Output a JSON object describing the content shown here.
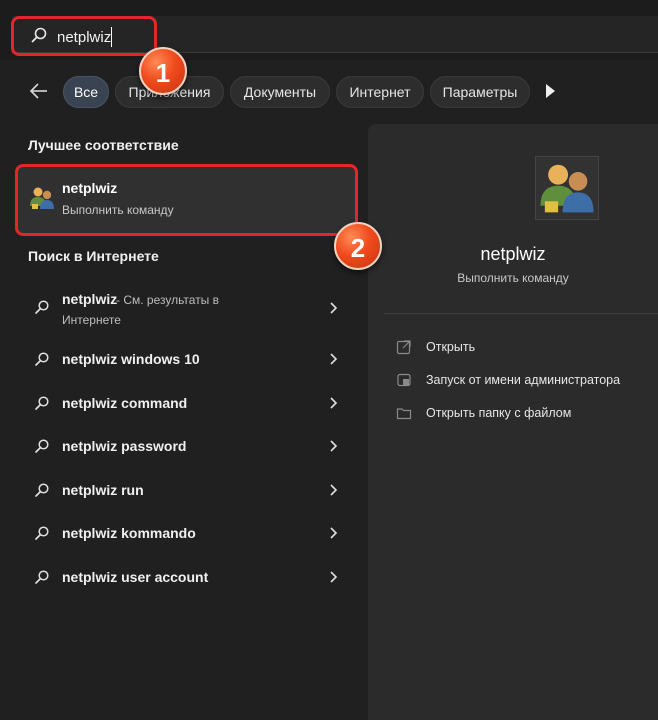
{
  "search": {
    "query": "netplwiz",
    "icon": "search-icon"
  },
  "filters": {
    "back_icon": "back-arrow-icon",
    "chips": [
      "Все",
      "Приложения",
      "Документы",
      "Интернет",
      "Параметры"
    ],
    "more_icon": "play-icon"
  },
  "best_match": {
    "heading": "Лучшее соответствие",
    "title": "netplwiz",
    "subtitle": "Выполнить команду",
    "icon": "users-icon"
  },
  "web_search": {
    "heading": "Поиск в Интернете",
    "items": [
      {
        "label": "netplwiz",
        "suffix": " - См. результаты в",
        "suffix2": "Интернете"
      },
      {
        "label": "netplwiz windows 10"
      },
      {
        "label": "netplwiz command"
      },
      {
        "label": "netplwiz password"
      },
      {
        "label": "netplwiz run"
      },
      {
        "label": "netplwiz kommando"
      },
      {
        "label": "netplwiz user account"
      }
    ]
  },
  "preview": {
    "title": "netplwiz",
    "subtitle": "Выполнить команду",
    "actions": [
      {
        "label": "Открыть",
        "icon": "open-icon"
      },
      {
        "label": "Запуск от имени администратора",
        "icon": "shield-icon"
      },
      {
        "label": "Открыть папку с файлом",
        "icon": "folder-icon"
      }
    ]
  },
  "annotations": {
    "step1": "1",
    "step2": "2",
    "color": "#e3262b"
  }
}
